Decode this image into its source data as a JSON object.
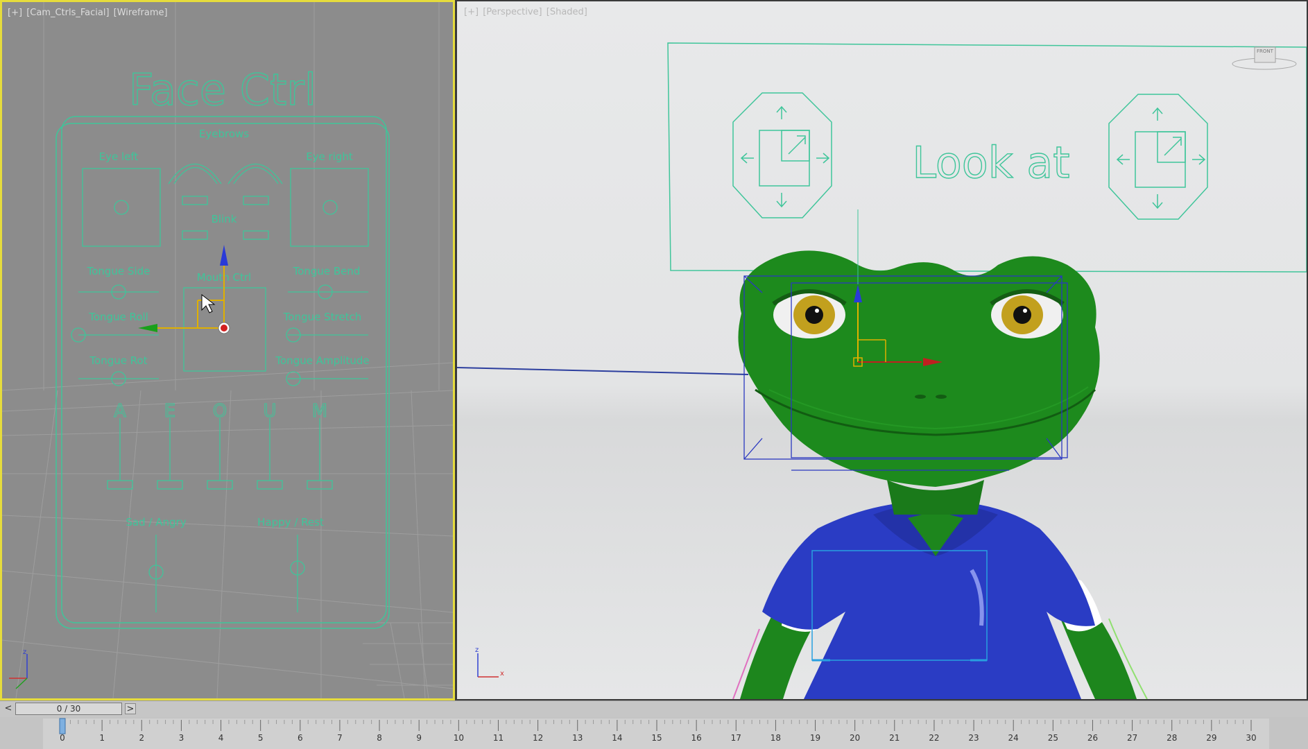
{
  "left_viewport": {
    "label_parts": [
      "[+]",
      "[Cam_Ctrls_Facial]",
      "[Wireframe]"
    ],
    "panel_title": "Face Ctrl",
    "labels": {
      "eyebrows": "Eyebrows",
      "eye_left": "Eye left",
      "eye_right": "Eye right",
      "tongue_side": "Tongue Side",
      "tongue_bend": "Tongue Bend",
      "tongue_roll": "Tongue Roll",
      "tongue_stretch": "Tongue Stretch",
      "tongue_rot": "Tongue Rot",
      "tongue_amplitude": "Tongue Amplitude",
      "mouth": "Mouth Ctrl",
      "blink": "Blink",
      "sad_angry": "Sad / Angry",
      "happy_rest": "Happy / Rest"
    },
    "phonemes": [
      "A",
      "E",
      "O",
      "U",
      "M"
    ]
  },
  "right_viewport": {
    "label_parts": [
      "[+]",
      "[Perspective]",
      "[Shaded]"
    ],
    "look_at_text": "Look at",
    "viewcube_label": "FRONT"
  },
  "time_slider": {
    "position_label": "0 / 30",
    "prev_label": "<",
    "next_label": ">"
  },
  "track_bar": {
    "current_frame": 0,
    "ticks": [
      "0",
      "1",
      "2",
      "3",
      "4",
      "5",
      "6",
      "7",
      "8",
      "9",
      "10",
      "11",
      "12",
      "13",
      "14",
      "15",
      "16",
      "17",
      "18",
      "19",
      "20",
      "21",
      "22",
      "23",
      "24",
      "25",
      "26",
      "27",
      "28",
      "29",
      "30"
    ]
  },
  "colors": {
    "active_viewport_border": "#e6dc3c",
    "control_green": "#3fc59a",
    "frog_green": "#1f8a1f",
    "shirt_blue": "#2a3fc9"
  }
}
